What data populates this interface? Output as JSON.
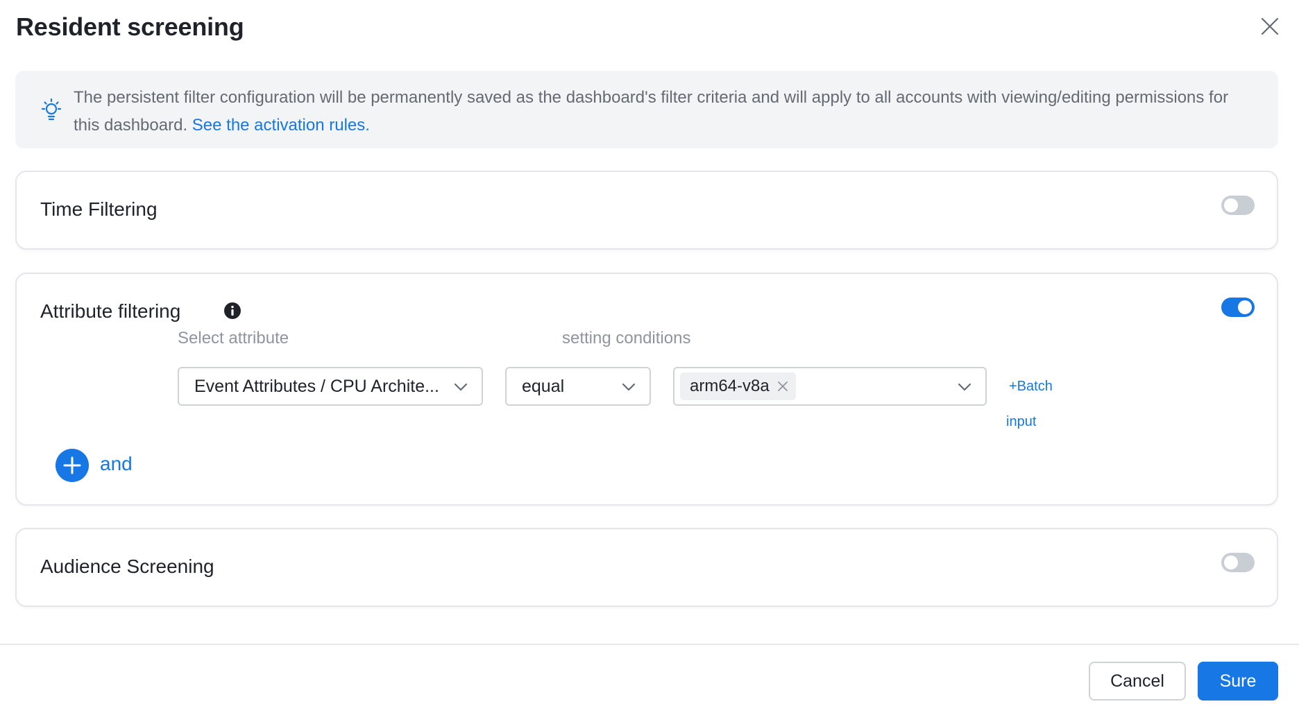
{
  "dialog": {
    "title": "Resident screening"
  },
  "notice": {
    "text": "The persistent filter configuration will be permanently saved as the dashboard's filter criteria and will apply to all accounts with viewing/editing permissions for this dashboard. ",
    "link": "See the activation rules."
  },
  "time_filtering": {
    "title": "Time Filtering",
    "enabled": false
  },
  "attribute_filtering": {
    "title": "Attribute filtering",
    "enabled": true,
    "select_attribute_label": "Select attribute",
    "setting_conditions_label": "setting conditions",
    "attribute_value": "Event Attributes / CPU Archite...",
    "operator_value": "equal",
    "tags": [
      "arm64-v8a"
    ],
    "batch_label": "+Batch",
    "batch_label_2": "input",
    "add_and_label": "and"
  },
  "audience_screening": {
    "title": "Audience Screening",
    "enabled": false
  },
  "footer": {
    "cancel_label": "Cancel",
    "sure_label": "Sure"
  },
  "colors": {
    "accent": "#1677e5",
    "toggle_off": "#c9cdd4",
    "notice_bg": "#f3f4f6"
  },
  "icons": [
    "close-icon",
    "lightbulb-icon",
    "info-icon",
    "chevron-down-icon",
    "tag-close-icon",
    "plus-icon"
  ]
}
